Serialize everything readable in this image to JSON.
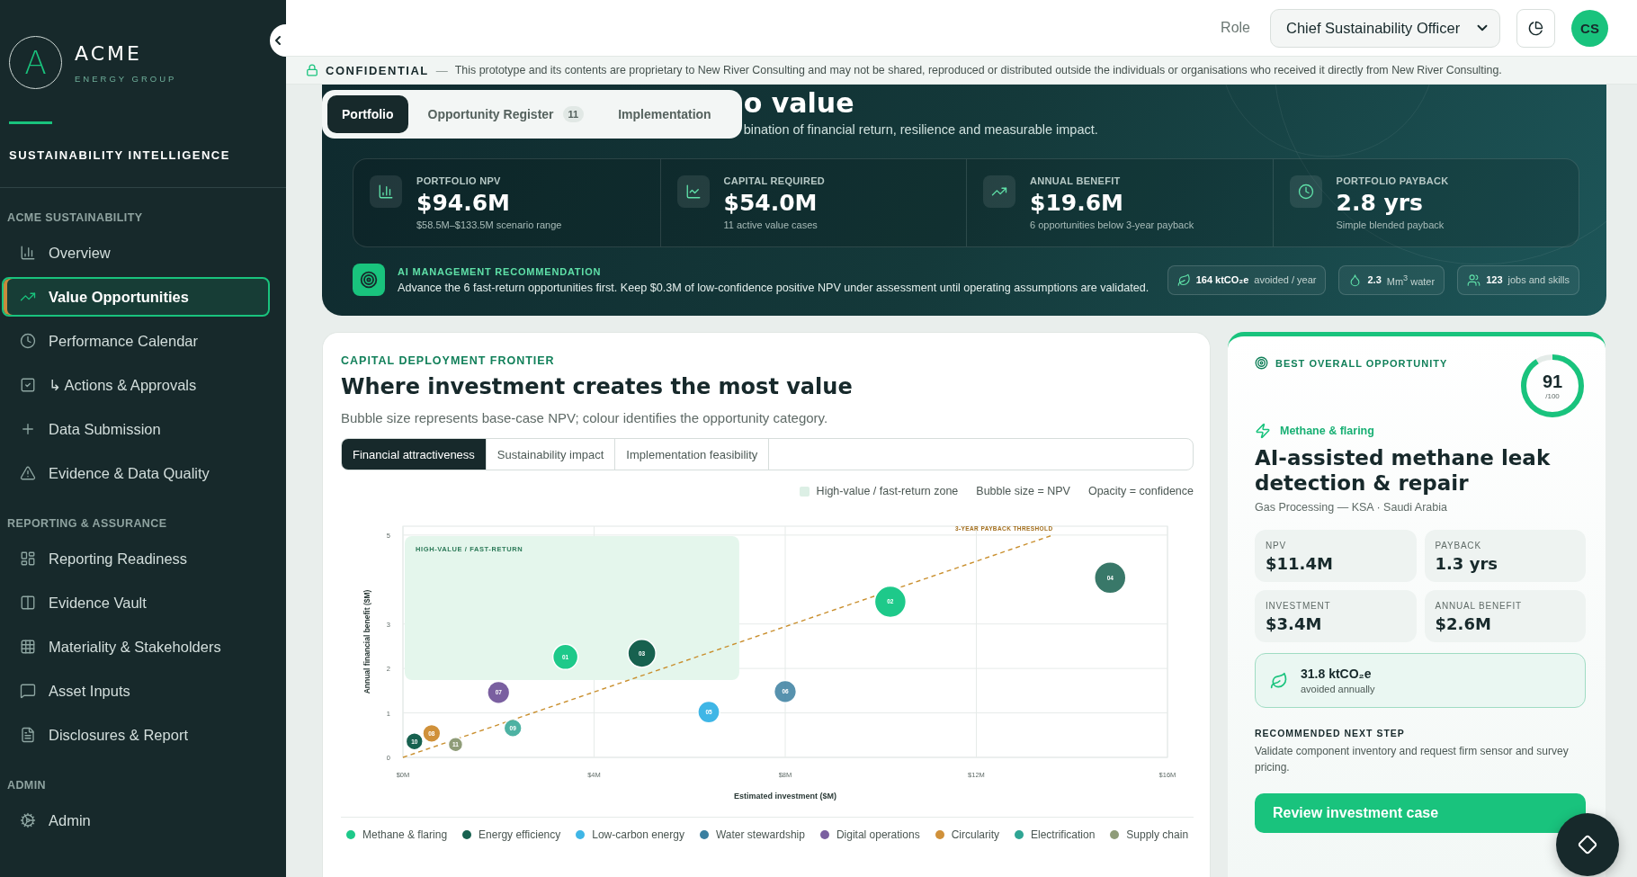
{
  "sidebar": {
    "logo_letter": "A",
    "brand": "ACME",
    "brand_sub": "ENERGY GROUP",
    "product": "SUSTAINABILITY INTELLIGENCE",
    "sections": [
      {
        "title": "ACME SUSTAINABILITY",
        "items": [
          {
            "label": "Overview",
            "selected": false
          },
          {
            "label": "Value Opportunities",
            "selected": true
          },
          {
            "label": "Performance Calendar",
            "selected": false
          },
          {
            "label": "↳ Actions & Approvals",
            "selected": false
          },
          {
            "label": "Data Submission",
            "selected": false
          },
          {
            "label": "Evidence & Data Quality",
            "selected": false
          }
        ]
      },
      {
        "title": "REPORTING & ASSURANCE",
        "items": [
          {
            "label": "Reporting Readiness",
            "selected": false
          },
          {
            "label": "Evidence Vault",
            "selected": false
          },
          {
            "label": "Materiality & Stakeholders",
            "selected": false
          },
          {
            "label": "Asset Inputs",
            "selected": false
          },
          {
            "label": "Disclosures & Report",
            "selected": false
          }
        ]
      },
      {
        "title": "ADMIN",
        "items": [
          {
            "label": "Admin",
            "selected": false
          }
        ]
      }
    ]
  },
  "topbar": {
    "role_label": "Role",
    "role_value": "Chief Sustainability Officer",
    "avatar": "CS"
  },
  "banner": {
    "title": "CONFIDENTIAL",
    "dash": "—",
    "text": "This prototype and its contents are proprietary to New River Consulting and may not be shared, reproduced or distributed outside the individuals or organisations who received it directly from New River Consulting."
  },
  "hero": {
    "tabs": [
      {
        "label": "Portfolio",
        "selected": true
      },
      {
        "label": "Opportunity Register",
        "badge": "11",
        "selected": false
      },
      {
        "label": "Implementation",
        "selected": false
      }
    ],
    "title_fragment": "o value",
    "subtitle_fragment": "bination of financial return, resilience and measurable impact.",
    "kpis": [
      {
        "label": "PORTFOLIO NPV",
        "value": "$94.6M",
        "note": "$58.5M–$133.5M scenario range"
      },
      {
        "label": "CAPITAL REQUIRED",
        "value": "$54.0M",
        "note": "11 active value cases"
      },
      {
        "label": "ANNUAL BENEFIT",
        "value": "$19.6M",
        "note": "6 opportunities below 3-year payback"
      },
      {
        "label": "PORTFOLIO PAYBACK",
        "value": "2.8 yrs",
        "note": "Simple blended payback"
      }
    ],
    "recommendation": {
      "title": "AI MANAGEMENT RECOMMENDATION",
      "text": "Advance the 6 fast-return opportunities first. Keep $0.3M of low-confidence positive NPV under assessment until operating assumptions are validated."
    },
    "impacts": [
      {
        "value": "164 ktCO₂e",
        "unit": "avoided / year"
      },
      {
        "value": "2.3",
        "unit": "Mm$^{3}$ water"
      },
      {
        "value": "123",
        "unit": "jobs and skills"
      }
    ]
  },
  "frontier": {
    "eyebrow": "CAPITAL DEPLOYMENT FRONTIER",
    "title": "Where investment creates the most value",
    "subtitle": "Bubble size represents base-case NPV; colour identifies the opportunity category.",
    "tabs": [
      {
        "label": "Financial attractiveness",
        "selected": true
      },
      {
        "label": "Sustainability impact",
        "selected": false
      },
      {
        "label": "Implementation feasibility",
        "selected": false
      }
    ],
    "keys": [
      {
        "kind": "swatch",
        "label": "High-value / fast-return zone"
      },
      {
        "kind": "text",
        "label": "Bubble size = NPV"
      },
      {
        "kind": "text",
        "label": "Opacity = confidence"
      }
    ],
    "chart_data": {
      "type": "scatter",
      "grid": true,
      "xlabel": "Estimated investment ($M)",
      "ylabel": "Annual financial benefit ($M)",
      "xlim": [
        0,
        16
      ],
      "ylim": [
        0,
        5.2
      ],
      "xticks": [
        {
          "value": 0,
          "label": "$0M"
        },
        {
          "value": 4,
          "label": "$4M"
        },
        {
          "value": 8,
          "label": "$8M"
        },
        {
          "value": 12,
          "label": "$12M"
        },
        {
          "value": 16,
          "label": "$16M"
        }
      ],
      "yticks": [
        0,
        1,
        2,
        3,
        5
      ],
      "series": [
        {
          "name": "Methane & flaring",
          "color": "#1ec98a",
          "x": [
            3.4,
            10.2
          ],
          "values": [
            2.26,
            3.5
          ],
          "sizes": [
            0.64,
            1
          ]
        },
        {
          "name": "Energy efficiency",
          "color": "#17614f",
          "x": [
            5.0,
            14.8,
            0.24
          ],
          "values": [
            2.34,
            4.04,
            0.36
          ],
          "sizes": [
            0.79,
            1,
            0.29
          ]
        },
        {
          "name": "Low-carbon energy",
          "color": "#3fb6e6",
          "x": [
            6.4
          ],
          "values": [
            1.02
          ],
          "sizes": [
            0.48
          ]
        },
        {
          "name": "Water stewardship",
          "color": "#3a7fa0",
          "x": [
            8.0
          ],
          "values": [
            1.48
          ],
          "sizes": [
            0.5
          ]
        },
        {
          "name": "Digital operations",
          "color": "#7a5fa0",
          "x": [
            2.0
          ],
          "values": [
            1.46
          ],
          "sizes": [
            0.5
          ]
        },
        {
          "name": "Circularity",
          "color": "#d0913a",
          "x": [
            0.6
          ],
          "values": [
            0.54
          ],
          "sizes": [
            0.32
          ]
        },
        {
          "name": "Electrification",
          "color": "#2fa594",
          "x": [
            2.3
          ],
          "values": [
            0.66
          ],
          "sizes": [
            0.32
          ]
        },
        {
          "name": "Supply chain",
          "color": "#8f9c78",
          "x": [
            1.1
          ],
          "values": [
            0.29
          ],
          "sizes": [
            0.21
          ]
        }
      ],
      "annotations": [
        "HIGH-VALUE / FAST-RETURN",
        "3-YEAR PAYBACK THRESHOLD",
        {
          "text": "01",
          "x": 3.4,
          "y": 2.26
        },
        {
          "text": "02",
          "x": 10.2,
          "y": 3.5
        },
        {
          "text": "03",
          "x": 5.0,
          "y": 2.34
        },
        {
          "text": "04",
          "x": 14.8,
          "y": 4.04
        },
        {
          "text": "05",
          "x": 6.4,
          "y": 1.02
        },
        {
          "text": "06",
          "x": 8.0,
          "y": 1.48
        },
        {
          "text": "07",
          "x": 2.0,
          "y": 1.46
        },
        {
          "text": "08",
          "x": 0.6,
          "y": 0.54
        },
        {
          "text": "09",
          "x": 2.3,
          "y": 0.66
        },
        {
          "text": "10",
          "x": 0.24,
          "y": 0.36
        },
        {
          "text": "11",
          "x": 1.1,
          "y": 0.29
        }
      ]
    }
  },
  "best": {
    "eyebrow": "BEST OVERALL OPPORTUNITY",
    "score": "91",
    "score_max": "/100",
    "level": 0.91,
    "category": "Methane & flaring",
    "title": "AI-assisted methane leak detection & repair",
    "location": "Gas Processing — KSA · Saudi Arabia",
    "metrics": [
      {
        "label": "NPV",
        "value": "$11.4M"
      },
      {
        "label": "PAYBACK",
        "value": "1.3 yrs"
      },
      {
        "label": "INVESTMENT",
        "value": "$3.4M"
      },
      {
        "label": "ANNUAL BENEFIT",
        "value": "$2.6M"
      }
    ],
    "impact": {
      "value": "31.8 ktCO₂e",
      "note": "avoided annually"
    },
    "next_step_title": "RECOMMENDED NEXT STEP",
    "next_step": "Validate component inventory and request firm sensor and survey pricing.",
    "cta": "Review investment case"
  }
}
